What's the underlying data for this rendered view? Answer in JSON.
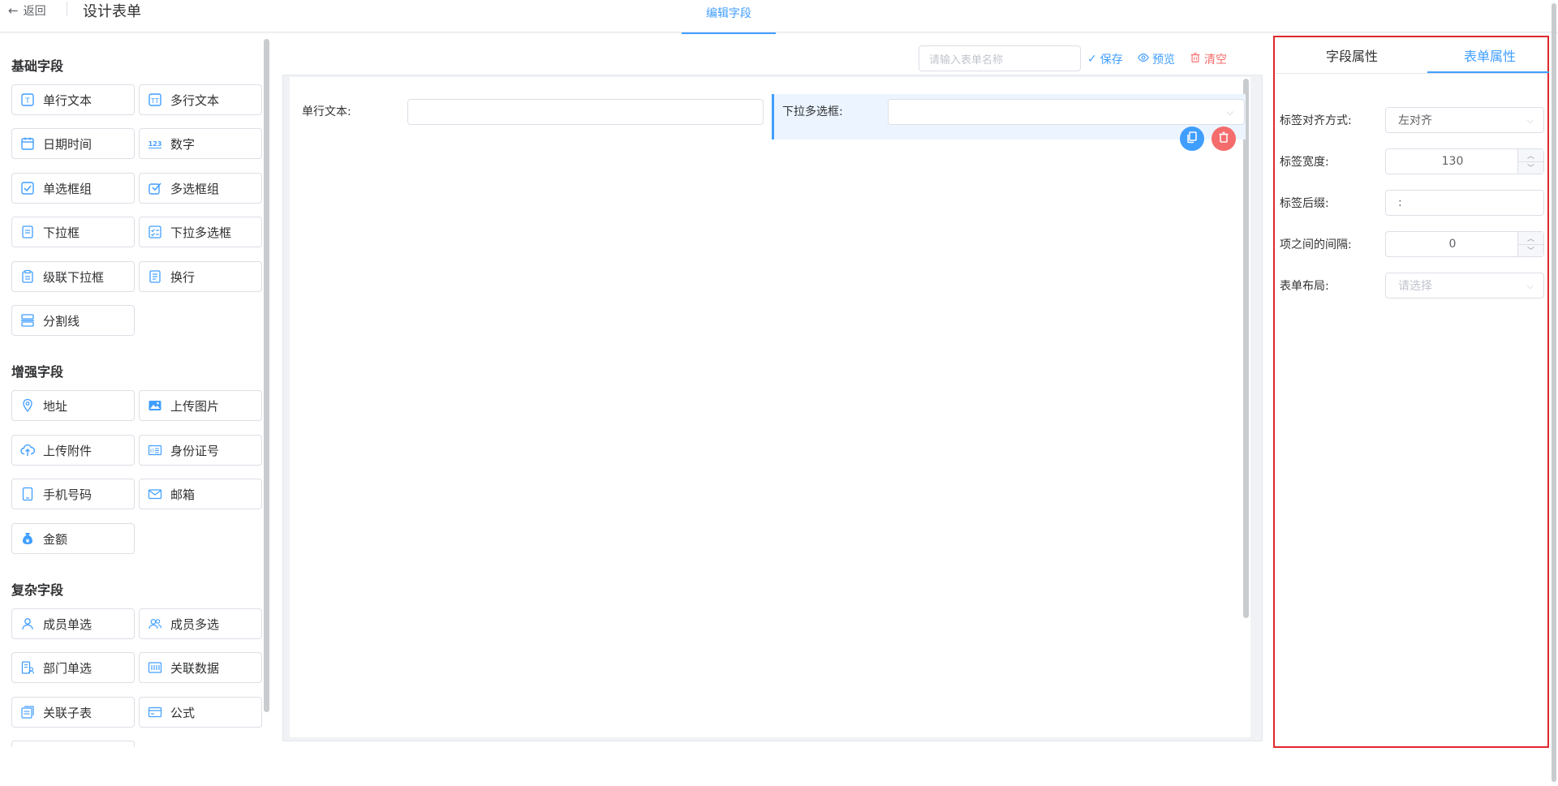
{
  "header": {
    "back_label": "返回",
    "title": "设计表单",
    "center_tab": "编辑字段"
  },
  "palette": {
    "basic_title": "基础字段",
    "enhanced_title": "增强字段",
    "complex_title": "复杂字段",
    "basic": [
      {
        "label": "单行文本",
        "icon": "text-input-icon"
      },
      {
        "label": "多行文本",
        "icon": "textarea-icon"
      },
      {
        "label": "日期时间",
        "icon": "calendar-icon"
      },
      {
        "label": "数字",
        "icon": "number-123-icon"
      },
      {
        "label": "单选框组",
        "icon": "radio-group-icon"
      },
      {
        "label": "多选框组",
        "icon": "checkbox-group-icon"
      },
      {
        "label": "下拉框",
        "icon": "select-icon"
      },
      {
        "label": "下拉多选框",
        "icon": "multi-select-icon"
      },
      {
        "label": "级联下拉框",
        "icon": "cascader-icon"
      },
      {
        "label": "换行",
        "icon": "line-break-icon"
      },
      {
        "label": "分割线",
        "icon": "divider-icon"
      }
    ],
    "enhanced": [
      {
        "label": "地址",
        "icon": "location-pin-icon"
      },
      {
        "label": "上传图片",
        "icon": "image-upload-icon"
      },
      {
        "label": "上传附件",
        "icon": "cloud-upload-icon"
      },
      {
        "label": "身份证号",
        "icon": "id-card-icon"
      },
      {
        "label": "手机号码",
        "icon": "phone-icon"
      },
      {
        "label": "邮箱",
        "icon": "mail-icon"
      },
      {
        "label": "金额",
        "icon": "money-bag-icon"
      }
    ],
    "complex": [
      {
        "label": "成员单选",
        "icon": "user-icon"
      },
      {
        "label": "成员多选",
        "icon": "users-icon"
      },
      {
        "label": "部门单选",
        "icon": "department-icon"
      },
      {
        "label": "关联数据",
        "icon": "linked-data-icon"
      },
      {
        "label": "关联子表",
        "icon": "subtable-icon"
      },
      {
        "label": "公式",
        "icon": "formula-icon"
      }
    ]
  },
  "toolbar": {
    "form_name_placeholder": "请输入表单名称",
    "save_label": "保存",
    "preview_label": "预览",
    "clear_label": "清空"
  },
  "canvas": {
    "field1_label": "单行文本:",
    "field2_label": "下拉多选框:"
  },
  "right_panel": {
    "tab_field": "字段属性",
    "tab_form": "表单属性",
    "label_align_label": "标签对齐方式:",
    "label_align_value": "左对齐",
    "label_width_label": "标签宽度:",
    "label_width_value": "130",
    "label_suffix_label": "标签后缀:",
    "label_suffix_value": ":",
    "item_gap_label": "项之间的间隔:",
    "item_gap_value": "0",
    "layout_label": "表单布局:",
    "layout_placeholder": "请选择"
  },
  "colors": {
    "accent": "#409eff",
    "danger": "#f56c6c",
    "highlight_border": "#e0282e"
  }
}
